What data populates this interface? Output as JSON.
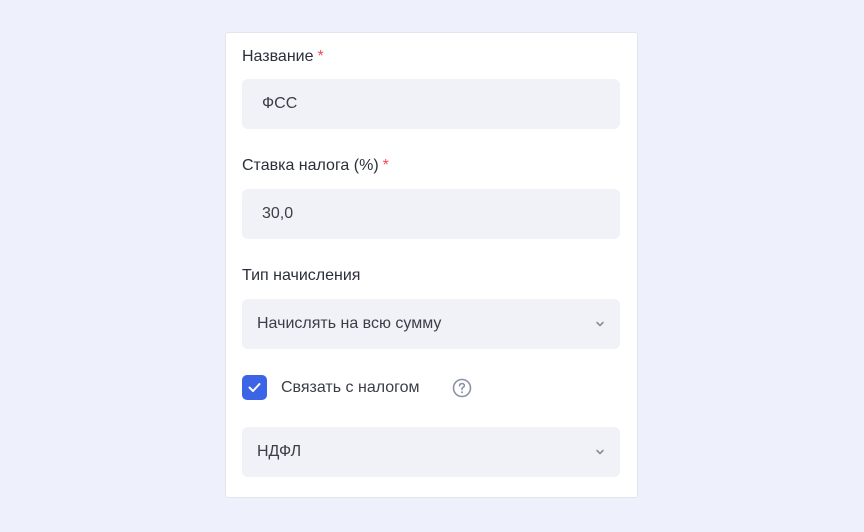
{
  "form": {
    "name_label": "Название",
    "name_required": "*",
    "name_value": "ФСС",
    "rate_label": "Ставка налога (%)",
    "rate_required": "*",
    "rate_value": "30,0",
    "accrual_label": "Тип начисления",
    "accrual_selected": "Начислять на всю сумму",
    "link_tax_label": "Связать с налогом",
    "link_tax_checked": true,
    "linked_tax_selected": "НДФЛ"
  },
  "icons": {
    "chevron": "chevron-down-icon",
    "help": "question-circle-icon",
    "check": "check-icon"
  },
  "colors": {
    "background": "#eef1fb",
    "card": "#ffffff",
    "field": "#f1f2f7",
    "required": "#ef4b5b",
    "checkbox": "#3c64e6",
    "help_icon": "#8a93a6"
  }
}
